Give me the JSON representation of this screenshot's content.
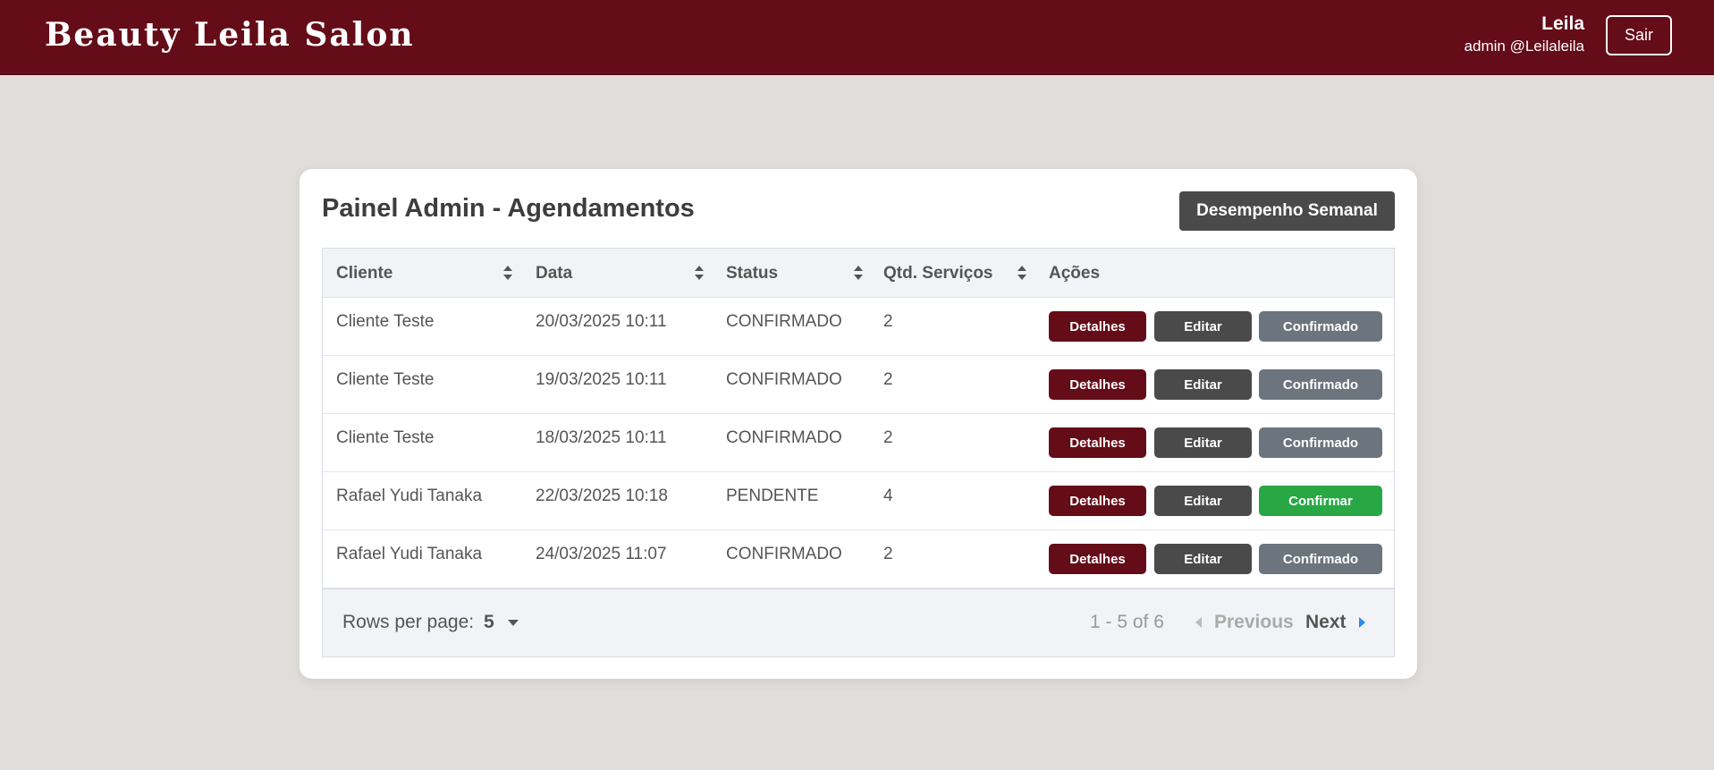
{
  "header": {
    "brand": "Beauty Leila Salon",
    "user_name": "Leila",
    "user_sub": "admin @Leilaleila",
    "logout_label": "Sair"
  },
  "panel": {
    "title": "Painel Admin - Agendamentos",
    "weekly_button": "Desempenho Semanal"
  },
  "table": {
    "columns": [
      "Cliente",
      "Data",
      "Status",
      "Qtd. Serviços",
      "Ações"
    ],
    "rows": [
      {
        "cliente": "Cliente Teste",
        "data": "20/03/2025 10:11",
        "status": "CONFIRMADO",
        "qtd": "2",
        "details": "Detalhes",
        "edit": "Editar",
        "state": "Confirmado"
      },
      {
        "cliente": "Cliente Teste",
        "data": "19/03/2025 10:11",
        "status": "CONFIRMADO",
        "qtd": "2",
        "details": "Detalhes",
        "edit": "Editar",
        "state": "Confirmado"
      },
      {
        "cliente": "Cliente Teste",
        "data": "18/03/2025 10:11",
        "status": "CONFIRMADO",
        "qtd": "2",
        "details": "Detalhes",
        "edit": "Editar",
        "state": "Confirmado"
      },
      {
        "cliente": "Rafael Yudi Tanaka",
        "data": "22/03/2025 10:18",
        "status": "PENDENTE",
        "qtd": "4",
        "details": "Detalhes",
        "edit": "Editar",
        "state": "Confirmar"
      },
      {
        "cliente": "Rafael Yudi Tanaka",
        "data": "24/03/2025 11:07",
        "status": "CONFIRMADO",
        "qtd": "2",
        "details": "Detalhes",
        "edit": "Editar",
        "state": "Confirmado"
      }
    ]
  },
  "pagination": {
    "rows_per_page_label": "Rows per page:",
    "rows_per_page": "5",
    "range": "1 - 5 of 6",
    "previous": "Previous",
    "next": "Next"
  },
  "colors": {
    "brand": "#640c18",
    "details_button": "#640c18",
    "edit_button": "#4a4a4a",
    "confirmed_button": "#6c757d",
    "confirm_button": "#28a745",
    "page_background": "#e0ddda",
    "next_arrow": "#2f8be6"
  }
}
